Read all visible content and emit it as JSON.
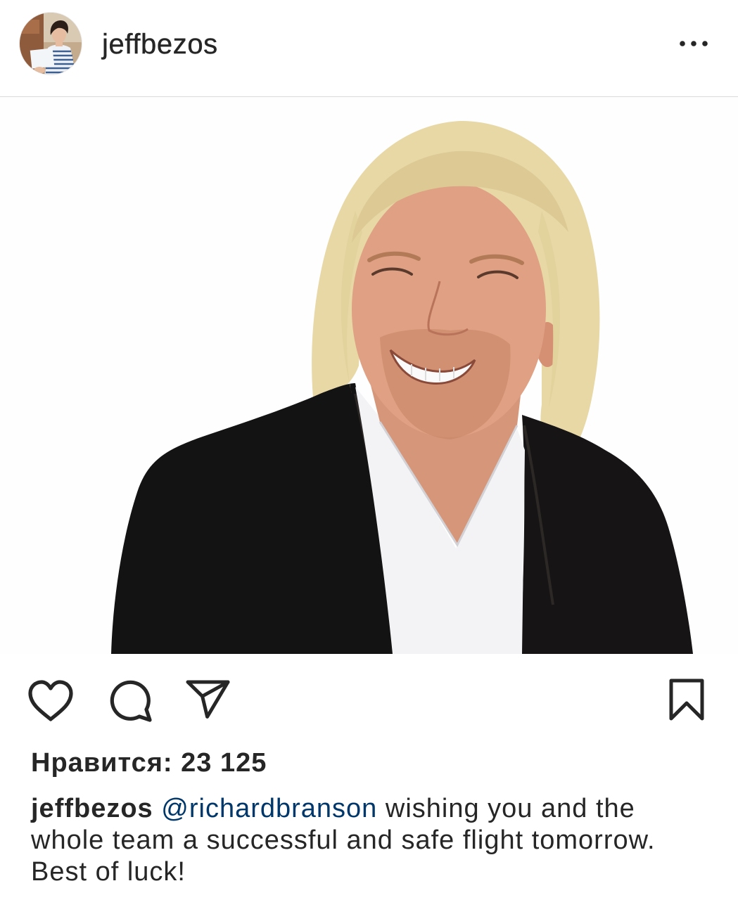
{
  "header": {
    "username": "jeffbezos"
  },
  "icons": {
    "more": "more-dots-icon",
    "like": "heart-icon",
    "comment": "comment-icon",
    "share": "paper-plane-icon",
    "save": "bookmark-icon"
  },
  "likes": {
    "label": "Нравится:",
    "count": "23 125"
  },
  "caption": {
    "username": "jeffbezos",
    "mention": "@richardbranson",
    "text": "wishing you and the whole team a successful and safe flight tomorrow. Best of luck!"
  },
  "colors": {
    "text": "#262626",
    "link": "#00376b",
    "divider": "#dbdbdb",
    "background": "#ffffff"
  }
}
